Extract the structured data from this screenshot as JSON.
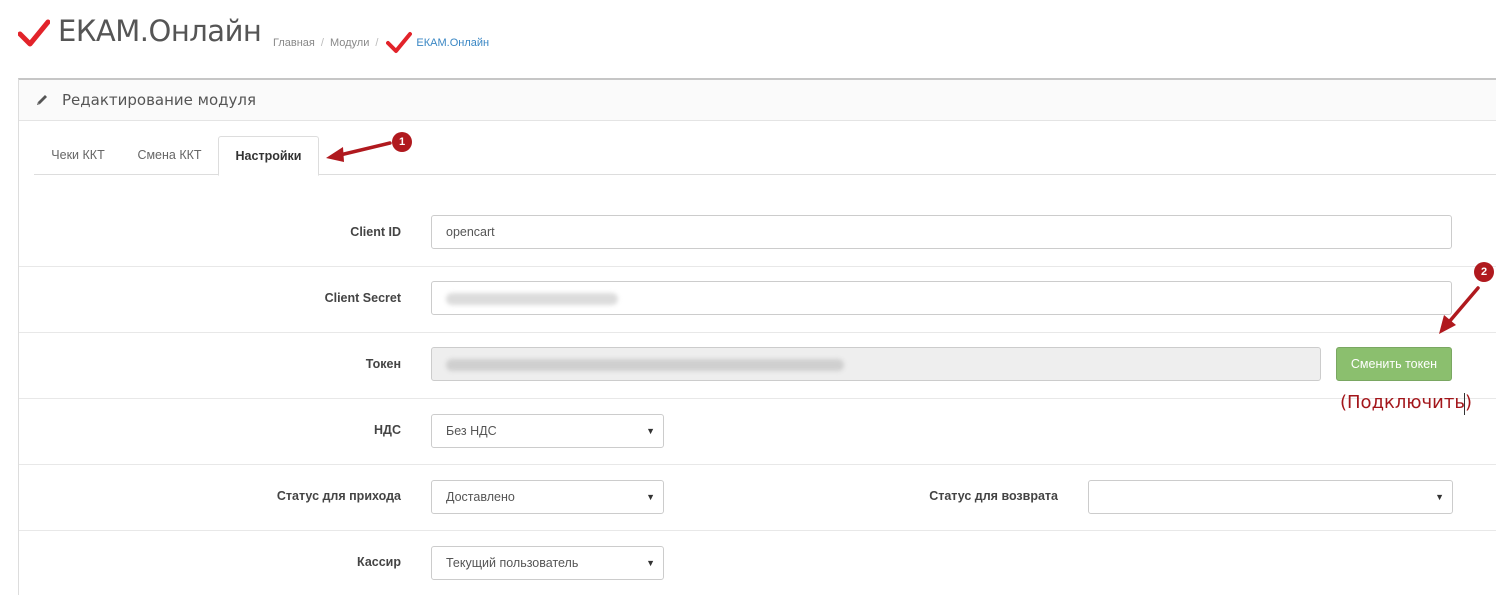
{
  "header": {
    "title": "ЕКАМ.Онлайн",
    "breadcrumb": [
      "Главная",
      "Модули",
      "ЕКАМ.Онлайн"
    ],
    "logo_icon": "red-checkmark-icon",
    "accent_color": "#e2232a"
  },
  "panel": {
    "title": "Редактирование модуля",
    "title_icon": "pencil-icon"
  },
  "tabs": [
    {
      "label": "Чеки ККТ",
      "active": false
    },
    {
      "label": "Смена ККТ",
      "active": false
    },
    {
      "label": "Настройки",
      "active": true
    }
  ],
  "form": {
    "client_id": {
      "label": "Client ID",
      "value": "opencart"
    },
    "client_secret": {
      "label": "Client Secret"
    },
    "token": {
      "label": "Токен",
      "button": "Сменить токен"
    },
    "nds": {
      "label": "НДС",
      "value": "Без НДС"
    },
    "status_income": {
      "label": "Статус для прихода",
      "value": "Доставлено"
    },
    "status_return": {
      "label": "Статус для возврата",
      "value": ""
    },
    "cashier": {
      "label": "Кассир",
      "value": "Текущий пользователь"
    }
  },
  "annotations": {
    "badge_1": "1",
    "badge_2": "2",
    "note": "(Подключить)",
    "color": "#b0191e"
  },
  "colors": {
    "button_green": "#8bbf6e",
    "link_blue": "#3a87c4"
  }
}
